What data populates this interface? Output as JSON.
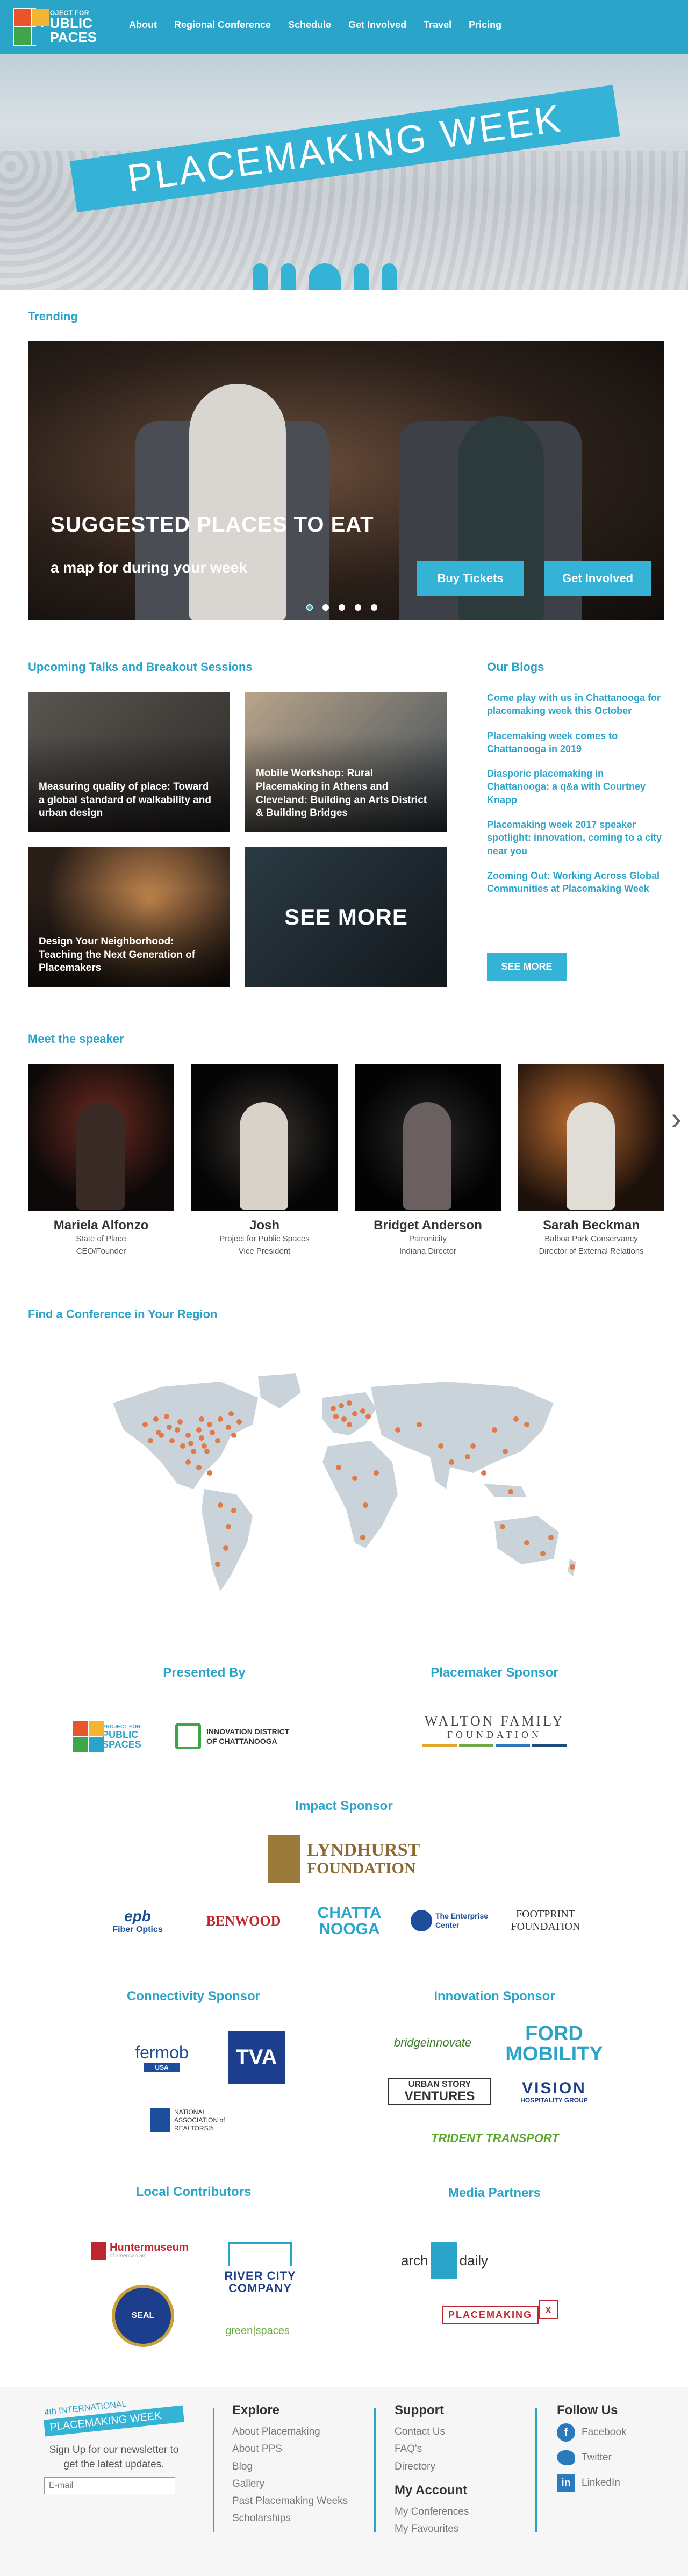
{
  "nav": {
    "logo_small": "PROJECT FOR",
    "logo_large": "PUBLIC SPACES",
    "links": [
      "About",
      "Regional Conference",
      "Schedule",
      "Get Involved",
      "Travel",
      "Pricing"
    ]
  },
  "hero": {
    "subtitle": "4th INTERNATIONAL",
    "title": "PLACEMAKING WEEK"
  },
  "trending": {
    "heading": "Trending",
    "slide_title": "SUGGESTED PLACES TO EAT",
    "slide_subtitle": "a map for during your week",
    "buy_label": "Buy Tickets",
    "involved_label": "Get Involved",
    "dot_count": 5
  },
  "talks": {
    "heading": "Upcoming Talks and Breakout Sessions",
    "cards": [
      "Measuring quality of place: Toward a global standard of walkability and urban design",
      "Mobile Workshop: Rural Placemaking in Athens and Cleveland: Building an Arts District & Building Bridges",
      "Design Your Neighborhood: Teaching the Next Generation of Placemakers"
    ],
    "see_more": "SEE MORE"
  },
  "blogs": {
    "heading": "Our Blogs",
    "items": [
      "Come play with us in Chattanooga for placemaking week this October",
      "Placemaking week comes to Chattanooga in 2019",
      "Diasporic placemaking in Chattanooga: a q&a with Courtney Knapp",
      "Placemaking week 2017 speaker spotlight: innovation, coming to a city near you",
      "Zooming Out: Working Across Global Communities at Placemaking Week"
    ],
    "see_more": "SEE MORE"
  },
  "speakers": {
    "heading": "Meet the speaker",
    "items": [
      {
        "name": "Mariela Alfonzo",
        "org": "State of Place",
        "role": "CEO/Founder"
      },
      {
        "name": "Josh",
        "org": "Project for Public Spaces",
        "role": "Vice President"
      },
      {
        "name": "Bridget Anderson",
        "org": "Patronicity",
        "role": "Indiana Director"
      },
      {
        "name": "Sarah Beckman",
        "org": "Balboa Park Conservancy",
        "role": "Director of External Relations"
      }
    ]
  },
  "region": {
    "heading": "Find a Conference in Your Region"
  },
  "sponsors": {
    "presented_by": "Presented By",
    "placemaker": "Placemaker Sponsor",
    "impact": "Impact Sponsor",
    "connectivity": "Connectivity Sponsor",
    "innovation": "Innovation Sponsor",
    "local": "Local Contributors",
    "media": "Media Partners",
    "logos": {
      "pps_small": "PROJECT FOR",
      "pps_large": "PUBLIC SPACES",
      "innovation_district_1": "INNOVATION DISTRICT",
      "innovation_district_2": "OF CHATTANOOGA",
      "walton_1": "WALTON FAMILY",
      "walton_2": "FOUNDATION",
      "lyndhurst_1": "LYNDHURST",
      "lyndhurst_2": "FOUNDATION",
      "epb": "epb",
      "epb_sub": "Fiber Optics",
      "benwood": "BENWOOD",
      "chatta_1": "CHATTA",
      "chatta_2": "NOOGA",
      "enterprise_1": "The Enterprise",
      "enterprise_2": "Center",
      "footprint_1": "FOOTPRINT",
      "footprint_2": "FOUNDATION",
      "fermob": "fermob",
      "fermob_sub": "USA",
      "tva": "TVA",
      "nar_1": "NATIONAL",
      "nar_2": "ASSOCIATION of",
      "nar_3": "REALTORS®",
      "bridge": "bridgeinnovate",
      "ford_1": "FORD",
      "ford_2": "MOBILITY",
      "urban_1": "URBAN STORY",
      "urban_2": "VENTURES",
      "vision_1": "VISION",
      "vision_2": "HOSPITALITY GROUP",
      "trident": "TRIDENT TRANSPORT",
      "hunter": "Huntermuseum",
      "hunter_sub": "of american art",
      "river_1": "RIVER CITY",
      "river_2": "COMPANY",
      "seal": "SEAL",
      "greenspaces": "green|spaces",
      "arch_1": "arch",
      "arch_2": "daily",
      "placemaking": "PLACEMAKING",
      "placemaking_x": "x"
    }
  },
  "footer": {
    "banner_small": "4th INTERNATIONAL",
    "banner": "PLACEMAKING WEEK",
    "newsletter": "Sign Up for our newsletter to get the latest updates.",
    "email_placeholder": "E-mail",
    "explore_title": "Explore",
    "explore": [
      "About Placemaking",
      "About PPS",
      "Blog",
      "Gallery",
      "Past Placemaking Weeks",
      "Scholarships"
    ],
    "support_title": "Support",
    "support": [
      "Contact Us",
      "FAQ's",
      "Directory"
    ],
    "account_title": "My Account",
    "account": [
      "My Conferences",
      "My Favourites"
    ],
    "follow_title": "Follow Us",
    "social": [
      "Facebook",
      "Twitter",
      "LinkedIn"
    ]
  },
  "colors": {
    "accent": "#2aa4c8",
    "map_land": "#c9d3d9",
    "map_dot": "#e07a4a"
  }
}
